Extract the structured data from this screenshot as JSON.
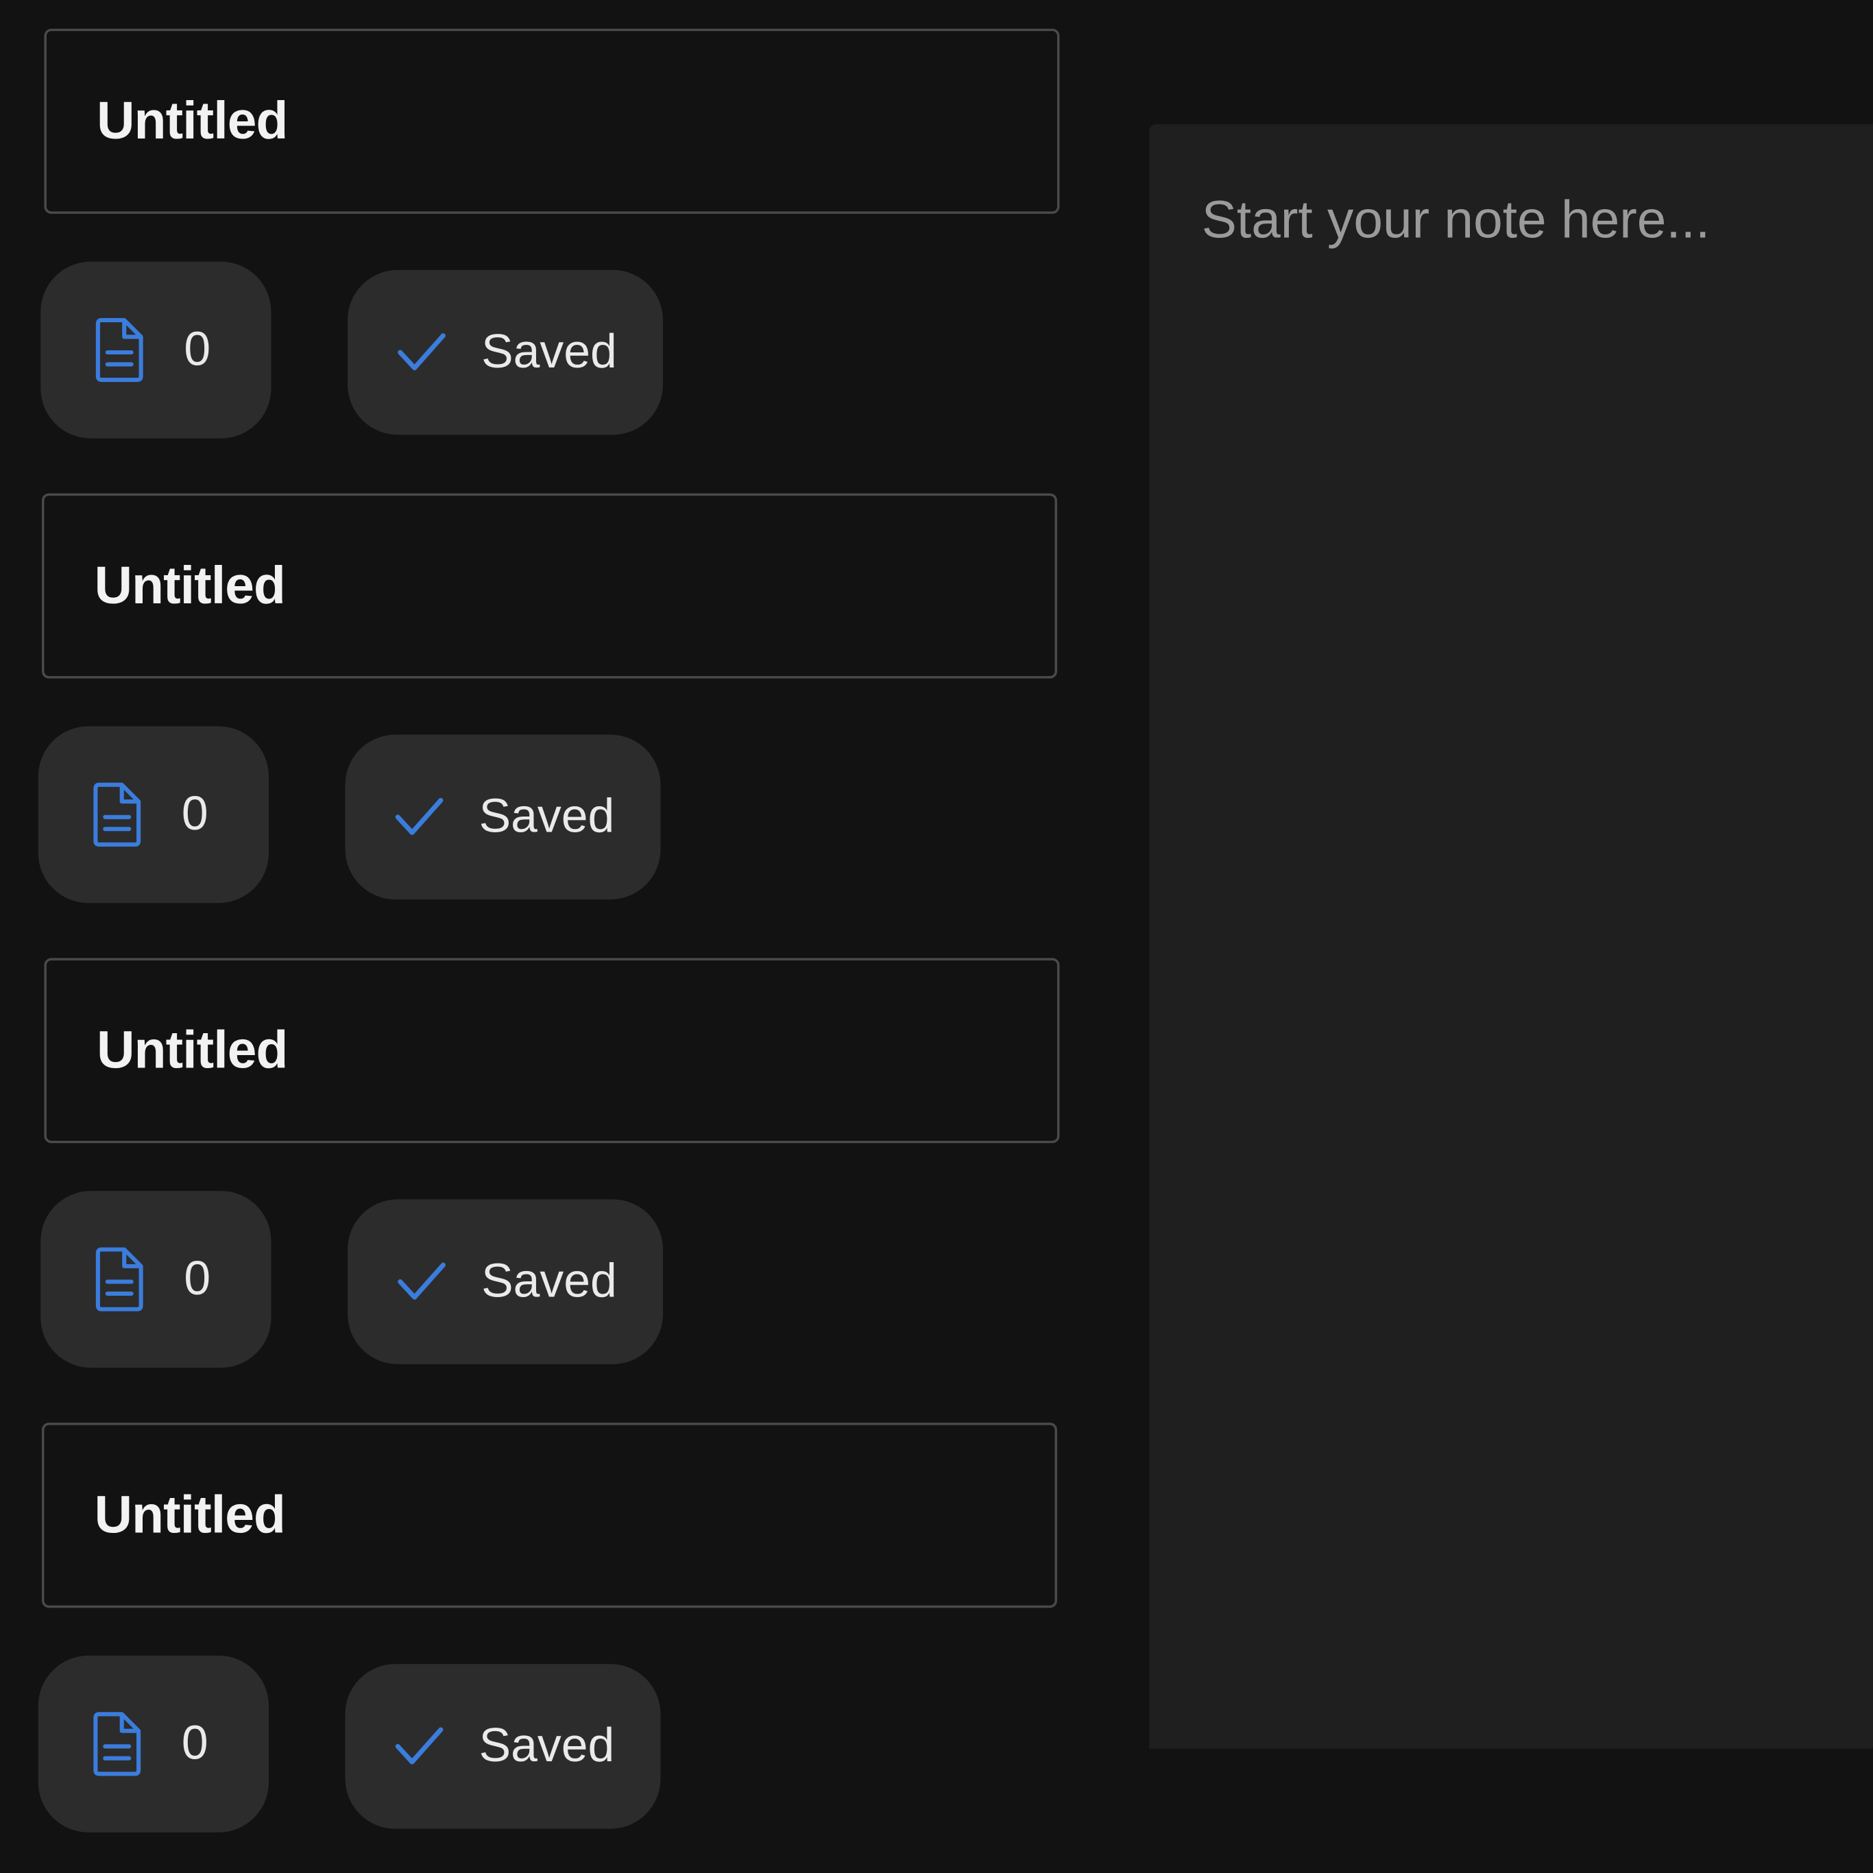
{
  "notes": [
    {
      "title": "Untitled",
      "word_count": "0",
      "status": "Saved"
    },
    {
      "title": "Untitled",
      "word_count": "0",
      "status": "Saved"
    },
    {
      "title": "Untitled",
      "word_count": "0",
      "status": "Saved"
    },
    {
      "title": "Untitled",
      "word_count": "0",
      "status": "Saved"
    }
  ],
  "editor": {
    "placeholder": "Start your note here..."
  },
  "icons": {
    "count": "document-icon",
    "status": "checkmark-icon"
  },
  "colors": {
    "background": "#121212",
    "pill": "#2c2c2c",
    "editor": "#1f1f1f",
    "accent": "#3b7ddd",
    "text": "#f2f2f2",
    "placeholder": "#9a9a9a"
  }
}
